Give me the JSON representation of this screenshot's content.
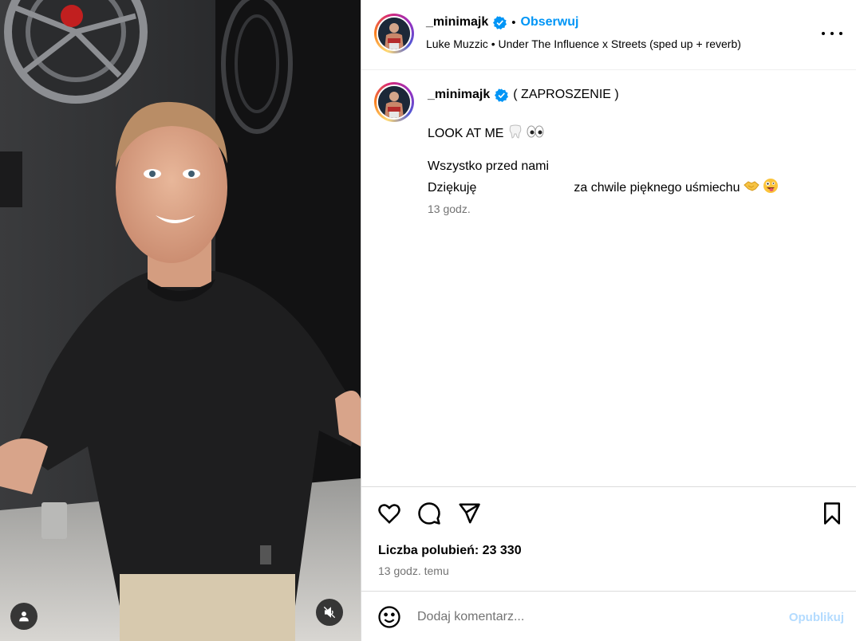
{
  "post": {
    "username": "_minimajk",
    "separator": "•",
    "follow_label": "Obserwuj",
    "audio": "Luke Muzzic • Under The Influence x Streets (sped up + reverb)",
    "more_icon": "more-horizontal-icon"
  },
  "caption": {
    "username": "_minimajk",
    "title": "( ZAPROSZENIE )",
    "line1": "LOOK AT ME",
    "line1_emojis": [
      "tooth-emoji",
      "eyes-emoji"
    ],
    "line2": "Wszystko przed nami",
    "line3_start": "Dziękuję",
    "line3_end": "za chwile pięknego uśmiechu",
    "line3_emojis": [
      "handshake-emoji",
      "zany-face-emoji"
    ],
    "time": "13 godz."
  },
  "actions": {
    "likes_text": "Liczba polubień: 23 330",
    "time_ago": "13 godz. temu"
  },
  "comment": {
    "placeholder": "Dodaj komentarz...",
    "publish_label": "Opublikuj"
  },
  "colors": {
    "accent": "#0095f6",
    "publish_disabled": "#b3dbff",
    "secondary_text": "#737373",
    "border": "#dbdbdb"
  }
}
